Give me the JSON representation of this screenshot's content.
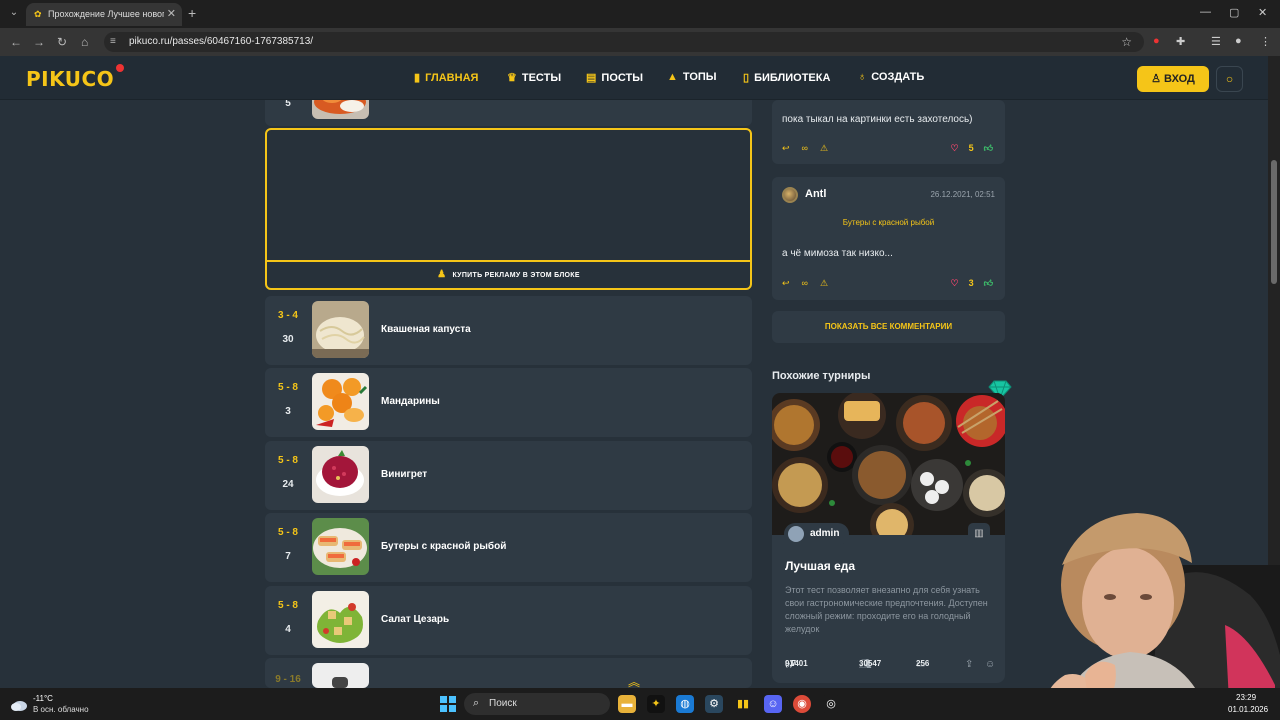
{
  "browser": {
    "tab_title": "Прохождение Лучшее новогод...",
    "url": "pikuco.ru/passes/60467160-1767385713/"
  },
  "header": {
    "logo": "PIKUCO",
    "nav": [
      {
        "label": "ГЛАВНАЯ",
        "icon": "bookmark-icon",
        "active": true
      },
      {
        "label": "ТЕСТЫ",
        "icon": "trophy-icon",
        "active": false
      },
      {
        "label": "ПОСТЫ",
        "icon": "document-icon",
        "active": false
      },
      {
        "label": "ТОПЫ",
        "icon": "bell-icon",
        "active": false
      },
      {
        "label": "БИБЛИОТЕКА",
        "icon": "book-icon",
        "active": false
      },
      {
        "label": "СОЗДАТЬ",
        "icon": "lightbulb-icon",
        "active": false
      }
    ],
    "login_label": "ВХОД"
  },
  "ad": {
    "label": "КУПИТЬ РЕКЛАМУ В ЭТОМ БЛОКЕ"
  },
  "list": {
    "top_partial_count": "5",
    "items": [
      {
        "rank": "3 - 4",
        "count": "30",
        "name": "Квашеная капуста"
      },
      {
        "rank": "5 - 8",
        "count": "3",
        "name": "Мандарины"
      },
      {
        "rank": "5 - 8",
        "count": "24",
        "name": "Винигрет"
      },
      {
        "rank": "5 - 8",
        "count": "7",
        "name": "Бутеры с красной рыбой"
      },
      {
        "rank": "5 - 8",
        "count": "4",
        "name": "Салат Цезарь"
      }
    ],
    "bottom_partial_rank": "9 - 16"
  },
  "comments": [
    {
      "text": "пока тыкал на картинки есть захотелось)",
      "votes": "5"
    },
    {
      "user": "Antl",
      "date": "26.12.2021, 02:51",
      "ref": "Бутеры с красной рыбой",
      "text": "а чё мимоза так низко...",
      "votes": "3"
    }
  ],
  "show_all_label": "ПОКАЗАТЬ ВСЕ КОММЕНТАРИИ",
  "similar": {
    "title": "Похожие турниры",
    "card": {
      "author": "admin",
      "title": "Лучшая еда",
      "description": "Этот тест позволяет внезапно для себя узнать свои гастрономические предпочтения. Доступен сложный режим: проходите его на голодный желудок",
      "rating": "9.7",
      "rating_count": "1401",
      "players": "30547",
      "comments": "256"
    }
  },
  "taskbar": {
    "temp": "-11°C",
    "weather": "В осн. облачно",
    "search": "Поиск",
    "time": "23:29",
    "date": "01.01.2026"
  }
}
